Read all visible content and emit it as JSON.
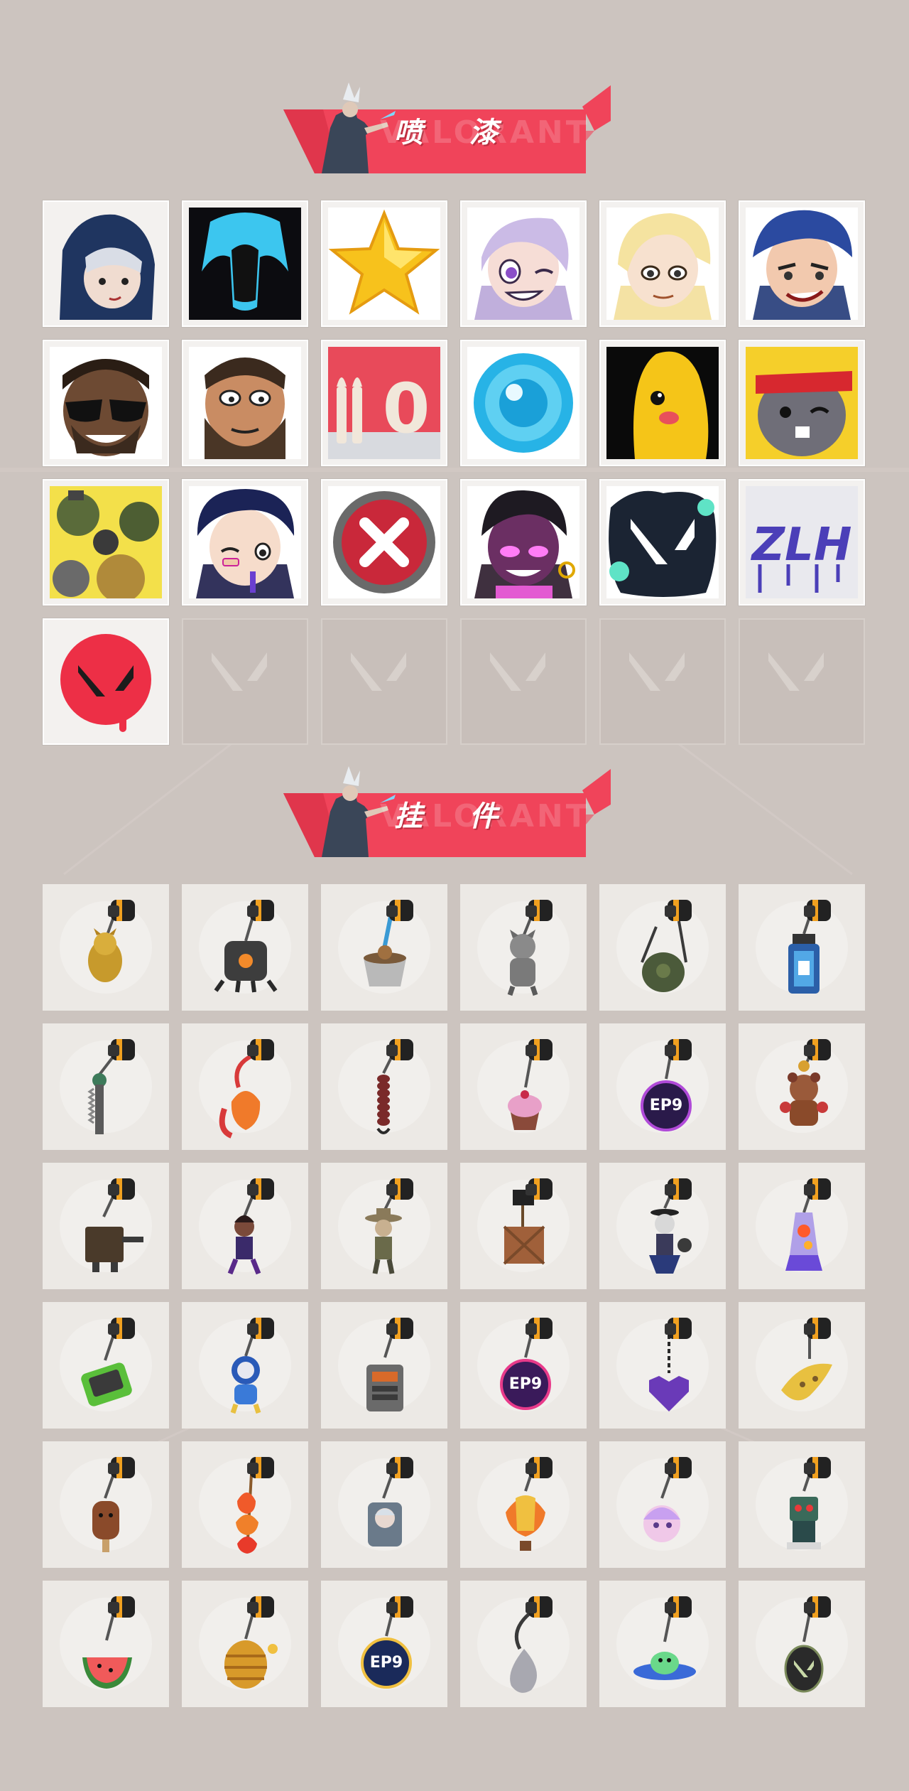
{
  "sections": {
    "sprays": {
      "title": "喷 漆",
      "watermark": "VALORANT",
      "items": [
        {
          "icon": "hooded-agent-spray-icon"
        },
        {
          "icon": "blue-mask-spray-icon"
        },
        {
          "icon": "star-spray-icon"
        },
        {
          "icon": "winking-girl-spray-icon"
        },
        {
          "icon": "blonde-girl-spray-icon"
        },
        {
          "icon": "smirking-girl-spray-icon"
        },
        {
          "icon": "sunglasses-agent-spray-icon"
        },
        {
          "icon": "bearded-agent-spray-icon"
        },
        {
          "icon": "ammo-zero-spray-icon"
        },
        {
          "icon": "blue-orb-spray-icon"
        },
        {
          "icon": "yellow-creature-spray-icon"
        },
        {
          "icon": "headband-bunny-spray-icon"
        },
        {
          "icon": "grenade-pile-spray-icon"
        },
        {
          "icon": "winking-boy-spray-icon"
        },
        {
          "icon": "red-x-spray-icon"
        },
        {
          "icon": "glowing-eyes-agent-spray-icon"
        },
        {
          "icon": "valorant-splatter-spray-icon"
        },
        {
          "icon": "graffiti-tag-spray-icon"
        },
        {
          "icon": "red-valorant-logo-spray-icon"
        },
        {
          "icon": "empty-slot-icon"
        },
        {
          "icon": "empty-slot-icon"
        },
        {
          "icon": "empty-slot-icon"
        },
        {
          "icon": "empty-slot-icon"
        },
        {
          "icon": "empty-slot-icon"
        }
      ]
    },
    "buddies": {
      "title": "挂 件",
      "watermark": "VALORANT",
      "items": [
        {
          "icon": "gold-cat-buddy-icon"
        },
        {
          "icon": "robot-drone-buddy-icon"
        },
        {
          "icon": "cup-buddy-icon"
        },
        {
          "icon": "grey-cat-buddy-icon"
        },
        {
          "icon": "canteen-buddy-icon"
        },
        {
          "icon": "blue-bottle-buddy-icon"
        },
        {
          "icon": "chainsaw-buddy-icon"
        },
        {
          "icon": "gummy-buddy-icon"
        },
        {
          "icon": "rope-knot-buddy-icon"
        },
        {
          "icon": "cupcake-buddy-icon"
        },
        {
          "icon": "ep9-medal-buddy-icon"
        },
        {
          "icon": "teddy-bear-buddy-icon"
        },
        {
          "icon": "turret-buddy-icon"
        },
        {
          "icon": "agent-figure-buddy-icon"
        },
        {
          "icon": "cowboy-figure-buddy-icon"
        },
        {
          "icon": "crate-buddy-icon"
        },
        {
          "icon": "scarecrow-buddy-icon"
        },
        {
          "icon": "lava-lamp-buddy-icon"
        },
        {
          "icon": "green-device-buddy-icon"
        },
        {
          "icon": "astronaut-buddy-icon"
        },
        {
          "icon": "radio-buddy-icon"
        },
        {
          "icon": "ep9-medal-purple-buddy-icon"
        },
        {
          "icon": "pixel-heart-buddy-icon"
        },
        {
          "icon": "banana-buddy-icon"
        },
        {
          "icon": "popsicle-buddy-icon"
        },
        {
          "icon": "fire-skewer-buddy-icon"
        },
        {
          "icon": "agent-tag-buddy-icon"
        },
        {
          "icon": "hot-air-balloon-buddy-icon"
        },
        {
          "icon": "anime-head-buddy-icon"
        },
        {
          "icon": "robot-toy-buddy-icon"
        },
        {
          "icon": "watermelon-buddy-icon"
        },
        {
          "icon": "beehive-buddy-icon"
        },
        {
          "icon": "ep9-medal-blue-buddy-icon"
        },
        {
          "icon": "silver-drop-buddy-icon"
        },
        {
          "icon": "ufo-buddy-icon"
        },
        {
          "icon": "valorant-tag-buddy-icon"
        }
      ]
    }
  },
  "colors": {
    "background": "#ccc4bf",
    "banner": "#f0445a",
    "banner_dark": "#d8324a",
    "valorant_red": "#ff4655",
    "slot_empty": "#c8bfba",
    "slot_bg": "#ece9e5"
  }
}
